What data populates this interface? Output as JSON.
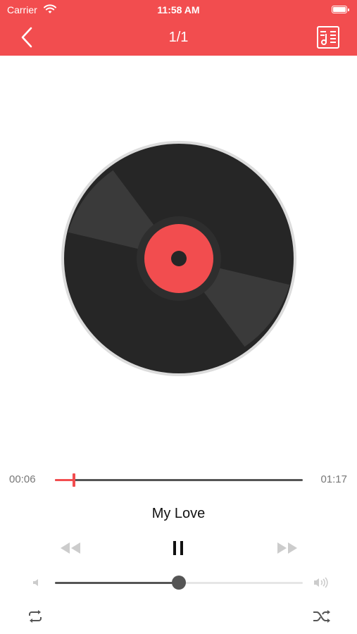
{
  "status_bar": {
    "carrier": "Carrier",
    "time": "11:58 AM"
  },
  "nav": {
    "title": "1/1",
    "back_icon": "chevron-left-icon",
    "playlist_icon": "music-list-icon"
  },
  "player": {
    "elapsed": "00:06",
    "duration": "01:17",
    "progress_fraction": 0.078,
    "song_title": "My Love",
    "is_playing": true,
    "volume_fraction": 0.5
  },
  "controls": {
    "rewind_icon": "rewind-icon",
    "pause_icon": "pause-icon",
    "forward_icon": "fast-forward-icon",
    "repeat_icon": "repeat-icon",
    "shuffle_icon": "shuffle-icon",
    "volume_min_icon": "volume-low-icon",
    "volume_max_icon": "volume-high-icon"
  },
  "colors": {
    "accent": "#f24d4f",
    "disc": "#262626",
    "control_dark": "#555555",
    "control_light": "#cccccc"
  }
}
